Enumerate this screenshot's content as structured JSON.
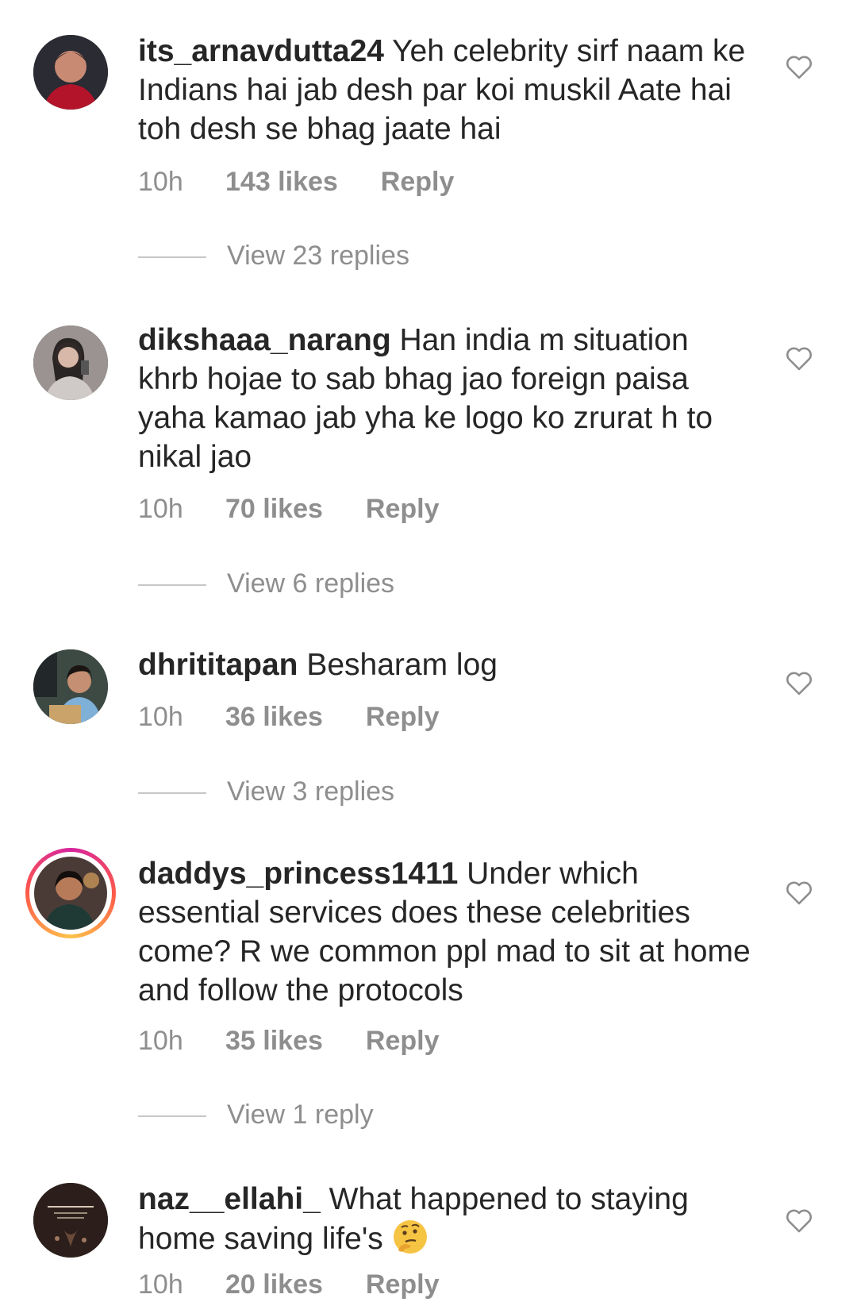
{
  "comments": [
    {
      "username": "its_arnavdutta24",
      "text": " Yeh celebrity sirf naam ke Indians hai jab desh par koi muskil Aate hai toh desh se bhag jaate hai",
      "time": "10h",
      "likes": "143 likes",
      "reply": "Reply",
      "view_replies": "View 23 replies"
    },
    {
      "username": "dikshaaa_narang",
      "text": " Han india m situation khrb hojae to sab bhag jao foreign paisa yaha kamao jab yha ke logo ko zrurat h to nikal jao",
      "time": "10h",
      "likes": "70 likes",
      "reply": "Reply",
      "view_replies": "View 6 replies"
    },
    {
      "username": "dhrititapan",
      "text": " Besharam log",
      "time": "10h",
      "likes": "36 likes",
      "reply": "Reply",
      "view_replies": "View 3 replies"
    },
    {
      "username": "daddys_princess1411",
      "text": " Under which essential services does these celebrities come? R we common ppl mad to sit at home and follow the protocols",
      "time": "10h",
      "likes": "35 likes",
      "reply": "Reply",
      "view_replies": "View 1 reply"
    },
    {
      "username": "naz__ellahi_",
      "text": " What happened to staying home saving life's ",
      "emoji": "thinking-face-emoji",
      "time": "10h",
      "likes": "20 likes",
      "reply": "Reply"
    }
  ],
  "icons": {
    "like": "heart-outline-icon"
  },
  "colors": {
    "text": "#262626",
    "meta": "#8e8e8e",
    "divider": "#c7c7c7"
  }
}
